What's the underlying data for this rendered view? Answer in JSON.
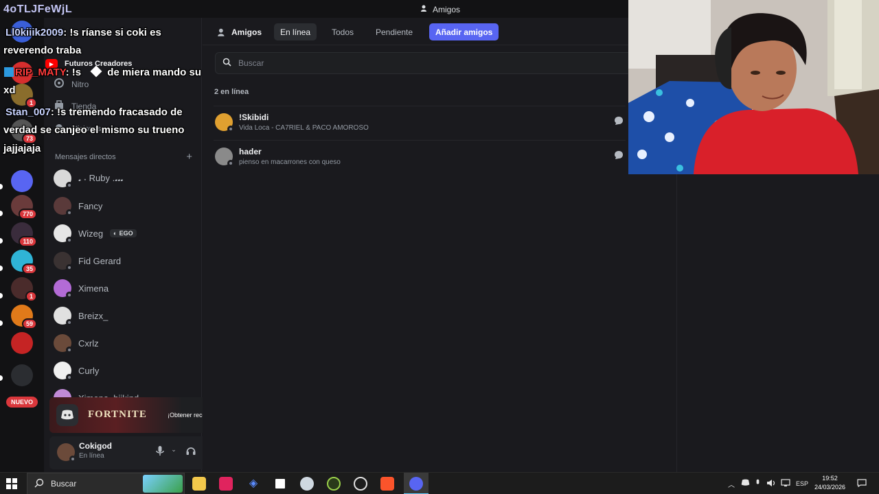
{
  "watermark": "4oTLJFeWjL",
  "titlebar": {
    "title": "Amigos"
  },
  "servers": [
    {
      "color": "#3a5fd9",
      "badge": ""
    },
    {
      "color": "#d62e2e",
      "badge": ""
    },
    {
      "color": "#8a6d2c",
      "badge": "1"
    },
    {
      "color": "#555",
      "badge": "73"
    },
    {
      "color": "#5865f2",
      "badge": ""
    },
    {
      "color": "#6a3b3b",
      "badge": "770"
    },
    {
      "color": "#3a2c3c",
      "badge": "110"
    },
    {
      "color": "#2fb4d6",
      "badge": "35"
    },
    {
      "color": "#4a2b2b",
      "badge": "1"
    },
    {
      "color": "#e07a1a",
      "badge": "59"
    },
    {
      "color": "#c52424",
      "badge": ""
    },
    {
      "color": "#2b2d31",
      "badge": ""
    }
  ],
  "servers_new_label": "NUEVO",
  "sidebar": {
    "items": [
      {
        "label": "Futuros Creadores",
        "icon": "youtube-icon"
      },
      {
        "label": "Nitro",
        "icon": "nitro-icon"
      },
      {
        "label": "Tienda",
        "icon": "shop-icon"
      },
      {
        "label": "Misiones",
        "icon": "quests-icon"
      }
    ],
    "dm_header": "Mensajes directos",
    "dm_add": "+",
    "dms": [
      {
        "name": "𝅘 ˖ Ruby .𝅘𝅘𝅘",
        "color": "#d9d9d9",
        "tag": ""
      },
      {
        "name": "Fancy",
        "color": "#5a3a3a",
        "tag": ""
      },
      {
        "name": "Wizeg",
        "color": "#e6e6e6",
        "tag": "EGO"
      },
      {
        "name": "Fid Gerard",
        "color": "#3a3232",
        "tag": ""
      },
      {
        "name": "Ximena",
        "color": "#b36bd6",
        "tag": ""
      },
      {
        "name": "Breizx_",
        "color": "#e0e0e0",
        "tag": ""
      },
      {
        "name": "Cxrlz",
        "color": "#6a4a3a",
        "tag": ""
      },
      {
        "name": "Curly",
        "color": "#f0f0f0",
        "tag": ""
      },
      {
        "name": "Ximena, biikind",
        "color": "#c08ad6",
        "tag": ""
      }
    ]
  },
  "promo": {
    "brand": "FORTNITE",
    "cta": "¡Obtener recompensa!"
  },
  "user": {
    "name": "Cokigod",
    "status": "En línea"
  },
  "topbar": {
    "friends_label": "Amigos",
    "tabs": [
      "En línea",
      "Todos",
      "Pendiente"
    ],
    "add_friends": "Añadir amigos"
  },
  "search": {
    "placeholder": "Buscar"
  },
  "online_count": "2 en línea",
  "friends": [
    {
      "name": "!Skibidi",
      "activity": "Vida Loca - CA7RIEL & PACO AMOROSO",
      "color": "#e0a030"
    },
    {
      "name": "hader",
      "activity": "pienso en macarrones con queso",
      "color": "#8a8a8a"
    }
  ],
  "stream_chat": [
    {
      "user": "Ll0kiiik2009",
      "text": ": !s ríanse si coki es",
      "cont": "reverendo traba"
    },
    {
      "user": "RIP_MATY",
      "text": ": !s",
      "cont2": "de miera mando su",
      "cont": "xd"
    },
    {
      "user": "Stan_007",
      "text": ": !s tremendo fracasado de",
      "cont": "verdad se canjeo el mismo su trueno",
      "cont3": "jajjajaja"
    }
  ],
  "taskbar": {
    "search_placeholder": "Buscar",
    "lang": "ESP",
    "time": "19:52",
    "date": "24/03/2026"
  }
}
